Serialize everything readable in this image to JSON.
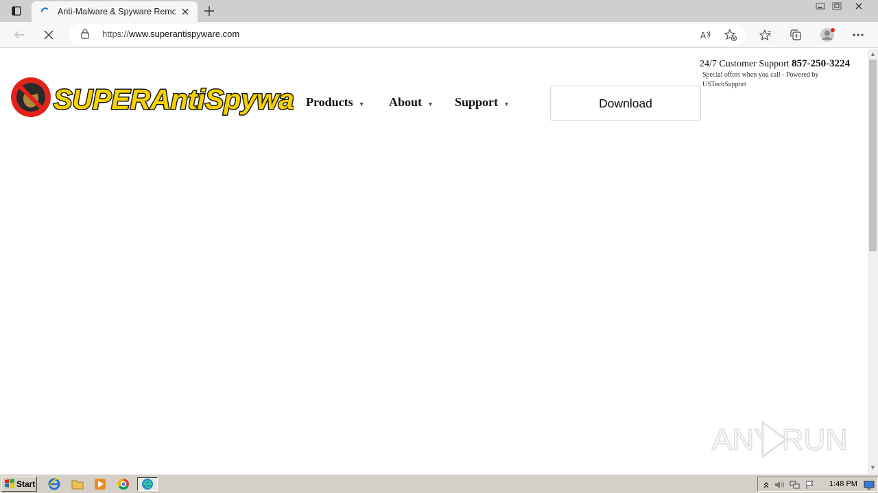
{
  "browser": {
    "tab": {
      "title": "Anti-Malware & Spyware Removal",
      "close_icon": "close-icon",
      "loading_icon": "loading-spinner-icon"
    },
    "new_tab_icon": "plus-icon",
    "window_controls": [
      "minimize-icon",
      "restore-icon",
      "close-icon"
    ],
    "address": {
      "scheme": "https://",
      "host": "www.superantispyware.com",
      "lock_icon": "lock-icon"
    },
    "toolbar_icons": [
      "back-icon",
      "stop-icon",
      "read-aloud-icon",
      "add-favorite-icon",
      "favorites-icon",
      "collections-icon",
      "profile-icon",
      "more-icon"
    ]
  },
  "site": {
    "logo_text": "SUPERAntiSpyware",
    "nav": [
      {
        "label": "Products",
        "caret": "▼"
      },
      {
        "label": "About",
        "caret": "▼"
      },
      {
        "label": "Support",
        "caret": "▼"
      }
    ],
    "download_label": "Download",
    "support_label": "24/7 Customer Support",
    "support_phone": "857-250-3224",
    "support_note": "Special offers when you call - Powered by USTechSupport"
  },
  "watermark": "ANY RUN",
  "taskbar": {
    "start_label": "Start",
    "apps": [
      "internet-explorer-icon",
      "folder-icon",
      "media-player-icon",
      "chrome-icon",
      "edge-icon"
    ],
    "tray_icons": [
      "show-hidden-icon",
      "volume-icon",
      "network-icon",
      "action-center-flag-icon",
      "desktop-icon"
    ],
    "clock": "1:48 PM"
  },
  "colors": {
    "logo_yellow": "#f5d100",
    "logo_red": "#e2231a",
    "tabbar": "#cfcfcf",
    "toolbar": "#f7f7f7"
  }
}
